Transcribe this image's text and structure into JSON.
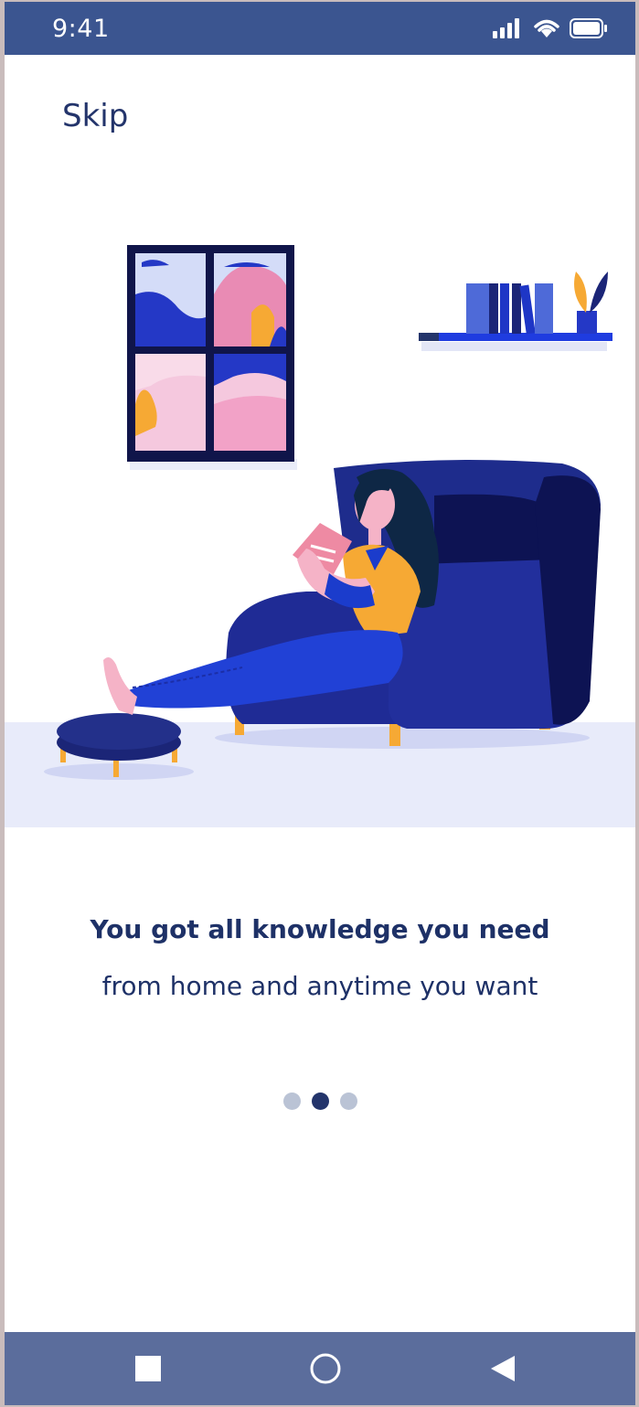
{
  "status_bar": {
    "time": "9:41",
    "icons": [
      "signal-icon",
      "wifi-icon",
      "battery-icon"
    ]
  },
  "skip_label": "Skip",
  "onboarding": {
    "title": "You got all knowledge you need",
    "subtitle": "from home and anytime you want",
    "page_count": 3,
    "active_page": 2
  },
  "nav_bar": {
    "buttons": [
      "recents-square-icon",
      "home-circle-icon",
      "back-triangle-icon"
    ]
  },
  "colors": {
    "primary": "#1e3167",
    "status_bar": "#3b5590",
    "nav_bar": "#5b6d9c",
    "dot_inactive": "#bac3d5",
    "accent_yellow": "#f6a934",
    "sofa": "#1b2577"
  }
}
